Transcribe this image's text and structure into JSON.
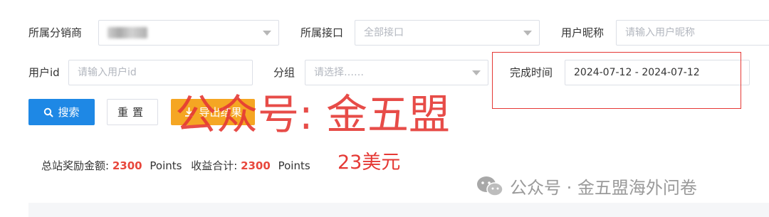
{
  "filters": {
    "distributor": {
      "label": "所属分销商"
    },
    "interface": {
      "label": "所属接口",
      "value": "全部接口"
    },
    "nickname": {
      "label": "用户昵称",
      "placeholder": "请输入用户昵称"
    },
    "user_id": {
      "label": "用户id",
      "placeholder": "请输入用户id"
    },
    "group": {
      "label": "分组",
      "placeholder": "请选择……"
    },
    "complete_time": {
      "label": "完成时间",
      "value": "2024-07-12 - 2024-07-12"
    }
  },
  "buttons": {
    "search": "搜索",
    "reset": "重置",
    "export": "导出结果"
  },
  "summary": {
    "total_reward_label": "总站奖励金额:",
    "total_reward_value": "2300",
    "unit1": "Points",
    "income_label": "收益合计:",
    "income_value": "2300",
    "unit2": "Points"
  },
  "annotations": {
    "watermark_center": "公众号: 金五盟",
    "usd_note": "23美元"
  },
  "bottom_watermark": {
    "text": "公众号 · 金五盟海外问卷",
    "icon": "wechat-icon"
  },
  "colors": {
    "primary": "#1e88e5",
    "warning": "#f5a623",
    "highlight_red": "#e53935",
    "number_red": "#e8473c"
  }
}
